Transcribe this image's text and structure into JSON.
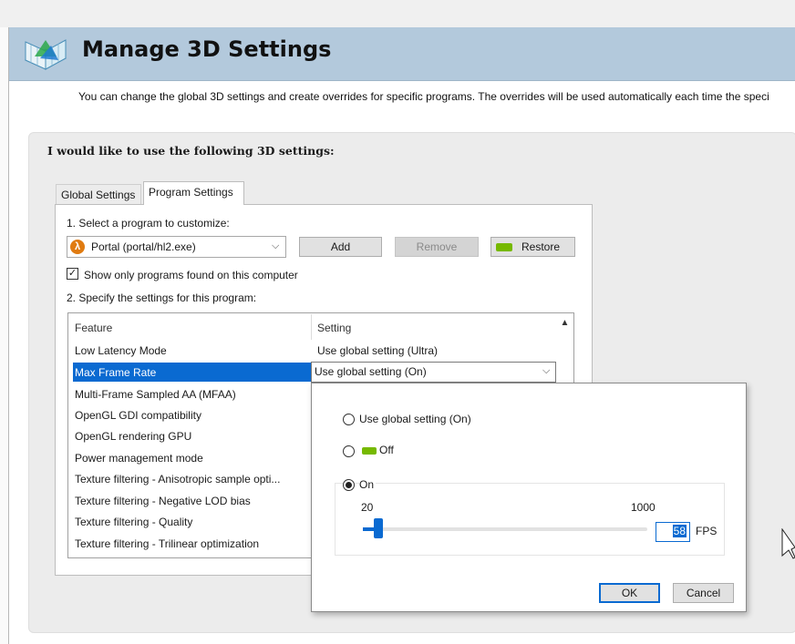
{
  "header": {
    "title": "Manage 3D Settings",
    "description": "You can change the global 3D settings and create overrides for specific programs. The overrides will be used automatically each time the speci"
  },
  "group_heading": "I would like to use the following 3D settings:",
  "tabs": [
    {
      "label": "Global Settings",
      "active": false
    },
    {
      "label": "Program Settings",
      "active": true
    }
  ],
  "program_settings": {
    "step1_label": "1. Select a program to customize:",
    "selected_program": "Portal (portal/hl2.exe)",
    "program_icon": "half-life-lambda-icon",
    "add_label": "Add",
    "remove_label": "Remove",
    "restore_label": "Restore",
    "show_only_label": "Show only programs found on this computer",
    "show_only_checked": true,
    "step2_label": "2. Specify the settings for this program:",
    "table": {
      "columns": [
        "Feature",
        "Setting"
      ],
      "rows": [
        {
          "feature": "Low Latency Mode",
          "setting": "Use global setting (Ultra)"
        },
        {
          "feature": "Max Frame Rate",
          "setting": "Use global setting (On)",
          "selected": true
        },
        {
          "feature": "Multi-Frame Sampled AA (MFAA)",
          "setting": ""
        },
        {
          "feature": "OpenGL GDI compatibility",
          "setting": ""
        },
        {
          "feature": "OpenGL rendering GPU",
          "setting": ""
        },
        {
          "feature": "Power management mode",
          "setting": ""
        },
        {
          "feature": "Texture filtering - Anisotropic sample opti...",
          "setting": ""
        },
        {
          "feature": "Texture filtering - Negative LOD bias",
          "setting": ""
        },
        {
          "feature": "Texture filtering - Quality",
          "setting": ""
        },
        {
          "feature": "Texture filtering - Trilinear optimization",
          "setting": ""
        }
      ]
    }
  },
  "popup": {
    "options": [
      {
        "label": "Use global setting (On)",
        "checked": false
      },
      {
        "label": "Off",
        "checked": false,
        "icon": "nvidia-green-icon"
      },
      {
        "label": "On",
        "checked": true
      }
    ],
    "slider": {
      "min_label": "20",
      "max_label": "1000",
      "value": 58,
      "unit": "FPS"
    },
    "ok_label": "OK",
    "cancel_label": "Cancel"
  },
  "colors": {
    "header_bg": "#b3c9dc",
    "selection_blue": "#0a6ad1",
    "nvidia_green": "#76b900"
  }
}
